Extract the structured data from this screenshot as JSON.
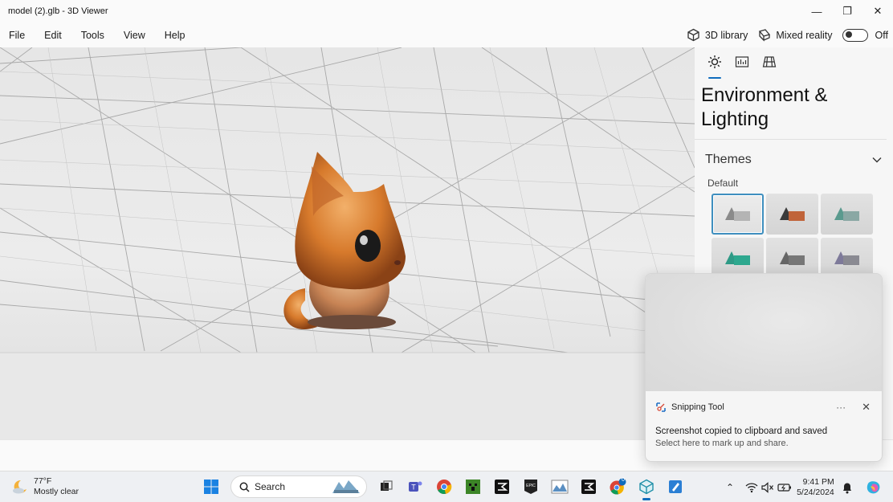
{
  "window": {
    "title": "model (2).glb - 3D Viewer",
    "minimize_glyph": "—",
    "restore_glyph": "❐",
    "close_glyph": "✕"
  },
  "menu": {
    "items": [
      "File",
      "Edit",
      "Tools",
      "View",
      "Help"
    ],
    "library_label": "3D library",
    "mixed_reality_label": "Mixed reality",
    "toggle_state": "Off"
  },
  "panel": {
    "tabs": [
      "environment-tab",
      "stats-tab",
      "grid-tab"
    ],
    "title": "Environment & Lighting",
    "themes_label": "Themes",
    "default_label": "Default",
    "themes": [
      {
        "name": "default-gray",
        "selected": true,
        "cone": "#8a8a8a",
        "box": "#b4b4b4"
      },
      {
        "name": "dark-orange",
        "selected": false,
        "cone": "#3a3a3a",
        "box": "#c0643a"
      },
      {
        "name": "teal-gray",
        "selected": false,
        "cone": "#5a9a8e",
        "box": "#8aa8a4"
      },
      {
        "name": "teal-green",
        "selected": false,
        "cone": "#2f9a86",
        "box": "#2ea88f"
      },
      {
        "name": "dark-gray",
        "selected": false,
        "cone": "#666666",
        "box": "#777777"
      },
      {
        "name": "lavender-gray",
        "selected": false,
        "cone": "#7e7a9a",
        "box": "#8a8a92"
      }
    ]
  },
  "notification": {
    "app": "Snipping Tool",
    "more_glyph": "···",
    "close_glyph": "✕",
    "message": "Screenshot copied to clipboard and saved",
    "submessage": "Select here to mark up and share."
  },
  "taskbar": {
    "temperature": "77°F",
    "condition": "Mostly clear",
    "search_placeholder": "Search",
    "chrome_badge": "0",
    "time": "9:41 PM",
    "date": "5/24/2024",
    "tray_chevron": "⌃"
  },
  "colors": {
    "accent": "#0f6cbd",
    "cat_orange": "#d9822b"
  }
}
